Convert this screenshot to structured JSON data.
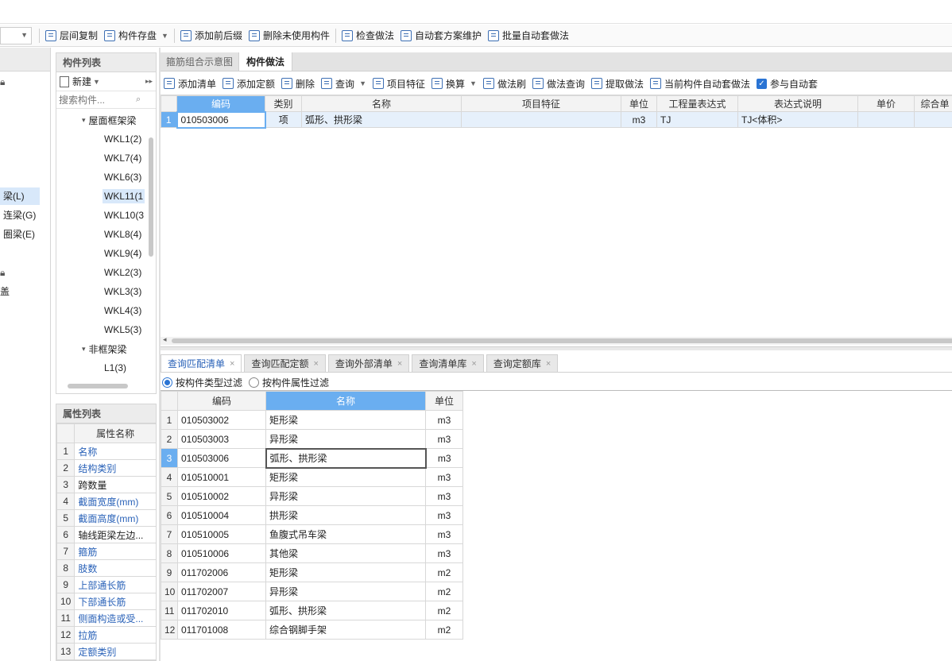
{
  "toolbar": {
    "items": [
      {
        "label": "层间复制",
        "icon": "copy-floor-icon"
      },
      {
        "label": "构件存盘",
        "icon": "save-component-icon",
        "dropdown": true
      },
      {
        "label": "添加前后缀",
        "icon": "prefix-suffix-icon"
      },
      {
        "label": "删除未使用构件",
        "icon": "delete-unused-icon"
      },
      {
        "label": "检查做法",
        "icon": "check-method-icon"
      },
      {
        "label": "自动套方案维护",
        "icon": "auto-scheme-icon"
      },
      {
        "label": "批量自动套做法",
        "icon": "batch-auto-icon"
      }
    ]
  },
  "left_strip": {
    "items": [
      "梁(L)",
      "连梁(G)",
      "圈梁(E)",
      "盖"
    ],
    "selected": "梁(L)"
  },
  "component_list": {
    "title": "构件列表",
    "new_label": "新建",
    "search_placeholder": "搜索构件...",
    "group1": "屋面框架梁",
    "group1_items": [
      "WKL1(2)",
      "WKL7(4)",
      "WKL6(3)",
      "WKL11(1",
      "WKL10(3",
      "WKL8(4)",
      "WKL9(4)",
      "WKL2(3)",
      "WKL3(3)",
      "WKL4(3)",
      "WKL5(3)"
    ],
    "selected": "WKL11(1",
    "group2": "非框架梁",
    "group2_items": [
      "L1(3)"
    ]
  },
  "property_list": {
    "title": "属性列表",
    "header": "属性名称",
    "rows": [
      {
        "no": "1",
        "name": "名称",
        "link": true
      },
      {
        "no": "2",
        "name": "结构类别",
        "link": true
      },
      {
        "no": "3",
        "name": "跨数量",
        "link": false
      },
      {
        "no": "4",
        "name": "截面宽度(mm)",
        "link": true
      },
      {
        "no": "5",
        "name": "截面高度(mm)",
        "link": true
      },
      {
        "no": "6",
        "name": "轴线距梁左边...",
        "link": false
      },
      {
        "no": "7",
        "name": "箍筋",
        "link": true
      },
      {
        "no": "8",
        "name": "肢数",
        "link": true
      },
      {
        "no": "9",
        "name": "上部通长筋",
        "link": true
      },
      {
        "no": "10",
        "name": "下部通长筋",
        "link": true
      },
      {
        "no": "11",
        "name": "侧面构造或受...",
        "link": true
      },
      {
        "no": "12",
        "name": "拉筋",
        "link": true
      },
      {
        "no": "13",
        "name": "定额类别",
        "link": true
      }
    ]
  },
  "main_tabs": [
    {
      "label": "箍筋组合示意图",
      "active": false
    },
    {
      "label": "构件做法",
      "active": true
    }
  ],
  "method_toolbar": [
    {
      "label": "添加清单",
      "icon": "add-list-icon"
    },
    {
      "label": "添加定额",
      "icon": "add-quota-icon"
    },
    {
      "label": "删除",
      "icon": "delete-icon"
    },
    {
      "label": "查询",
      "icon": "query-icon",
      "dropdown": true
    },
    {
      "label": "项目特征",
      "icon": "feature-icon"
    },
    {
      "label": "换算",
      "icon": "convert-icon",
      "dropdown": true
    },
    {
      "label": "做法刷",
      "icon": "method-brush-icon"
    },
    {
      "label": "做法查询",
      "icon": "method-query-icon"
    },
    {
      "label": "提取做法",
      "icon": "extract-method-icon"
    },
    {
      "label": "当前构件自动套做法",
      "icon": "current-auto-icon"
    }
  ],
  "auto_checkbox_label": "参与自动套",
  "method_table": {
    "headers": [
      "编码",
      "类别",
      "名称",
      "项目特征",
      "单位",
      "工程量表达式",
      "表达式说明",
      "单价",
      "综合单"
    ],
    "rows": [
      {
        "no": "1",
        "code": "010503006",
        "type": "项",
        "name": "弧形、拱形梁",
        "feature": "",
        "unit": "m3",
        "expr": "TJ",
        "desc": "TJ<体积>",
        "price": "",
        "total": ""
      }
    ]
  },
  "query_tabs": [
    {
      "label": "查询匹配清单",
      "active": true
    },
    {
      "label": "查询匹配定额",
      "active": false
    },
    {
      "label": "查询外部清单",
      "active": false
    },
    {
      "label": "查询清单库",
      "active": false
    },
    {
      "label": "查询定额库",
      "active": false
    }
  ],
  "filter": {
    "option1": "按构件类型过滤",
    "option2": "按构件属性过滤",
    "selected": 1
  },
  "match_table": {
    "headers": [
      "编码",
      "名称",
      "单位"
    ],
    "selected_row": 3,
    "rows": [
      {
        "no": "1",
        "code": "010503002",
        "name": "矩形梁",
        "unit": "m3"
      },
      {
        "no": "2",
        "code": "010503003",
        "name": "异形梁",
        "unit": "m3"
      },
      {
        "no": "3",
        "code": "010503006",
        "name": "弧形、拱形梁",
        "unit": "m3"
      },
      {
        "no": "4",
        "code": "010510001",
        "name": "矩形梁",
        "unit": "m3"
      },
      {
        "no": "5",
        "code": "010510002",
        "name": "异形梁",
        "unit": "m3"
      },
      {
        "no": "6",
        "code": "010510004",
        "name": "拱形梁",
        "unit": "m3"
      },
      {
        "no": "7",
        "code": "010510005",
        "name": "鱼腹式吊车梁",
        "unit": "m3"
      },
      {
        "no": "8",
        "code": "010510006",
        "name": "其他梁",
        "unit": "m3"
      },
      {
        "no": "9",
        "code": "011702006",
        "name": "矩形梁",
        "unit": "m2"
      },
      {
        "no": "10",
        "code": "011702007",
        "name": "异形梁",
        "unit": "m2"
      },
      {
        "no": "11",
        "code": "011702010",
        "name": "弧形、拱形梁",
        "unit": "m2"
      },
      {
        "no": "12",
        "code": "011701008",
        "name": "综合钢脚手架",
        "unit": "m2"
      }
    ]
  }
}
